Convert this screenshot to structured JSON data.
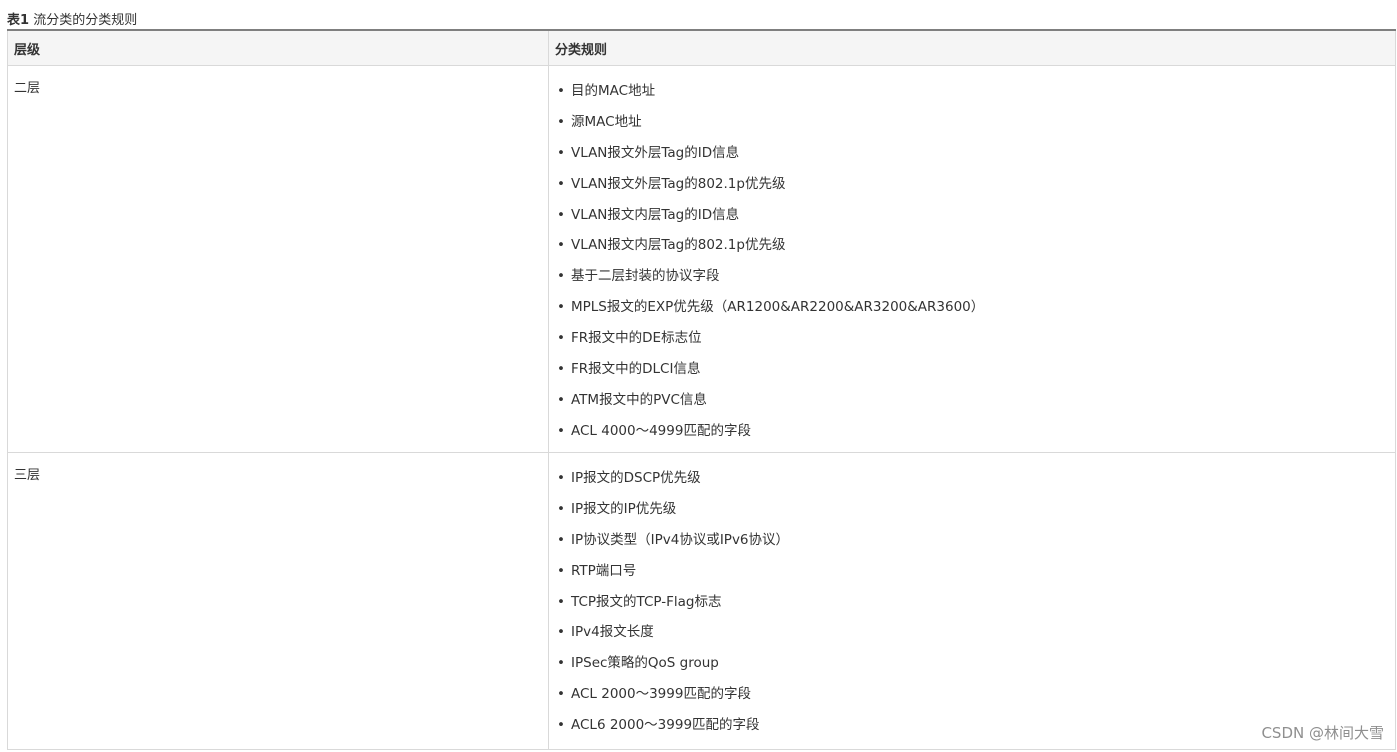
{
  "caption": {
    "label": "表1",
    "title": "流分类的分类规则"
  },
  "table": {
    "headers": [
      "层级",
      "分类规则"
    ],
    "rows": [
      {
        "level": "二层",
        "items": [
          "目的MAC地址",
          "源MAC地址",
          "VLAN报文外层Tag的ID信息",
          "VLAN报文外层Tag的802.1p优先级",
          "VLAN报文内层Tag的ID信息",
          "VLAN报文内层Tag的802.1p优先级",
          "基于二层封装的协议字段",
          "MPLS报文的EXP优先级（AR1200&AR2200&AR3200&AR3600）",
          "FR报文中的DE标志位",
          "FR报文中的DLCI信息",
          "ATM报文中的PVC信息",
          "ACL 4000～4999匹配的字段"
        ]
      },
      {
        "level": "三层",
        "items": [
          "IP报文的DSCP优先级",
          "IP报文的IP优先级",
          "IP协议类型（IPv4协议或IPv6协议）",
          "RTP端口号",
          "TCP报文的TCP-Flag标志",
          "IPv4报文长度",
          "IPSec策略的QoS group",
          "ACL 2000～3999匹配的字段",
          "ACL6 2000～3999匹配的字段"
        ]
      }
    ]
  },
  "watermark": "CSDN @林间大雪"
}
